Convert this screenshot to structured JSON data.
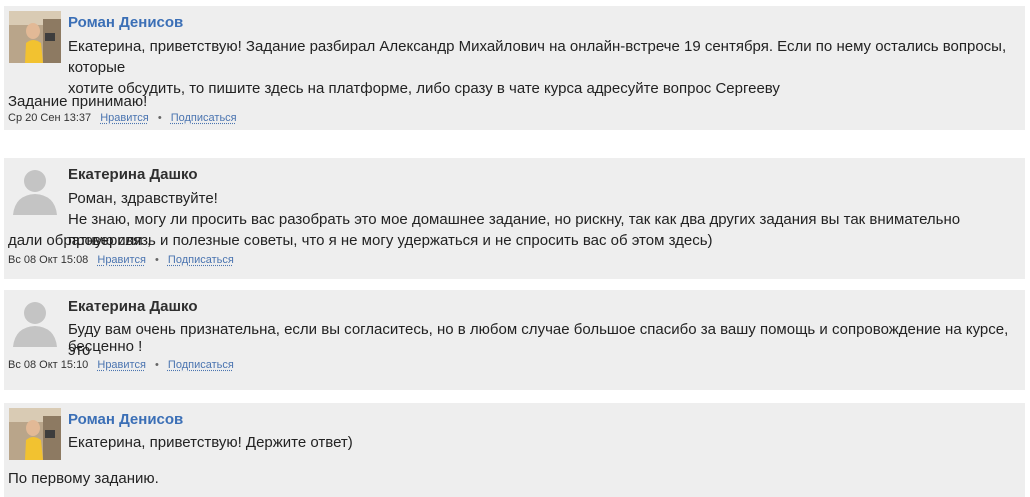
{
  "comments": [
    {
      "author": "Роман Денисов",
      "avatar_icon": "user-photo-icon",
      "lines": [
        "Екатерина, приветствую! Задание разбирал Александр Михайлович на онлайн-встрече 19 сентября. Если по нему остались вопросы, которые",
        "хотите обсудить, то пишите здесь на платформе, либо сразу в чате курса адресуйте вопрос Сергееву"
      ],
      "extra": "Задание принимаю!",
      "date": "Ср 20 Сен 13:37",
      "like": "Нравится",
      "subscribe": "Подписаться"
    },
    {
      "author": "Екатерина Дашко",
      "avatar_icon": "default-user-avatar-icon",
      "lines": [
        "Роман, здравствуйте!",
        "Не знаю, могу ли просить вас разобрать это мое домашнее задание, но рискну, так как два других задания вы так внимательно проверили ,",
        "дали обратную связь и полезные советы, что я не могу удержаться и не спросить вас об этом здесь)"
      ],
      "date": "Вс 08 Окт 15:08",
      "like": "Нравится",
      "subscribe": "Подписаться"
    },
    {
      "author": "Екатерина Дашко",
      "avatar_icon": "default-user-avatar-icon",
      "lines": [
        "Буду вам очень признательна, если вы согласитесь, но в любом случае большое спасибо за вашу помощь и сопровождение на курсе, это",
        "бесценно !"
      ],
      "date": "Вс 08 Окт 15:10",
      "like": "Нравится",
      "subscribe": "Подписаться"
    },
    {
      "author": "Роман Денисов",
      "avatar_icon": "user-photo-icon",
      "lines": [
        "Екатерина, приветствую! Держите ответ)"
      ],
      "extra": "По первому заданию."
    }
  ],
  "colors": {
    "author_link": "#3b6fb6",
    "meta_link": "#4a74b0",
    "card_bg": "#eeeeee"
  }
}
